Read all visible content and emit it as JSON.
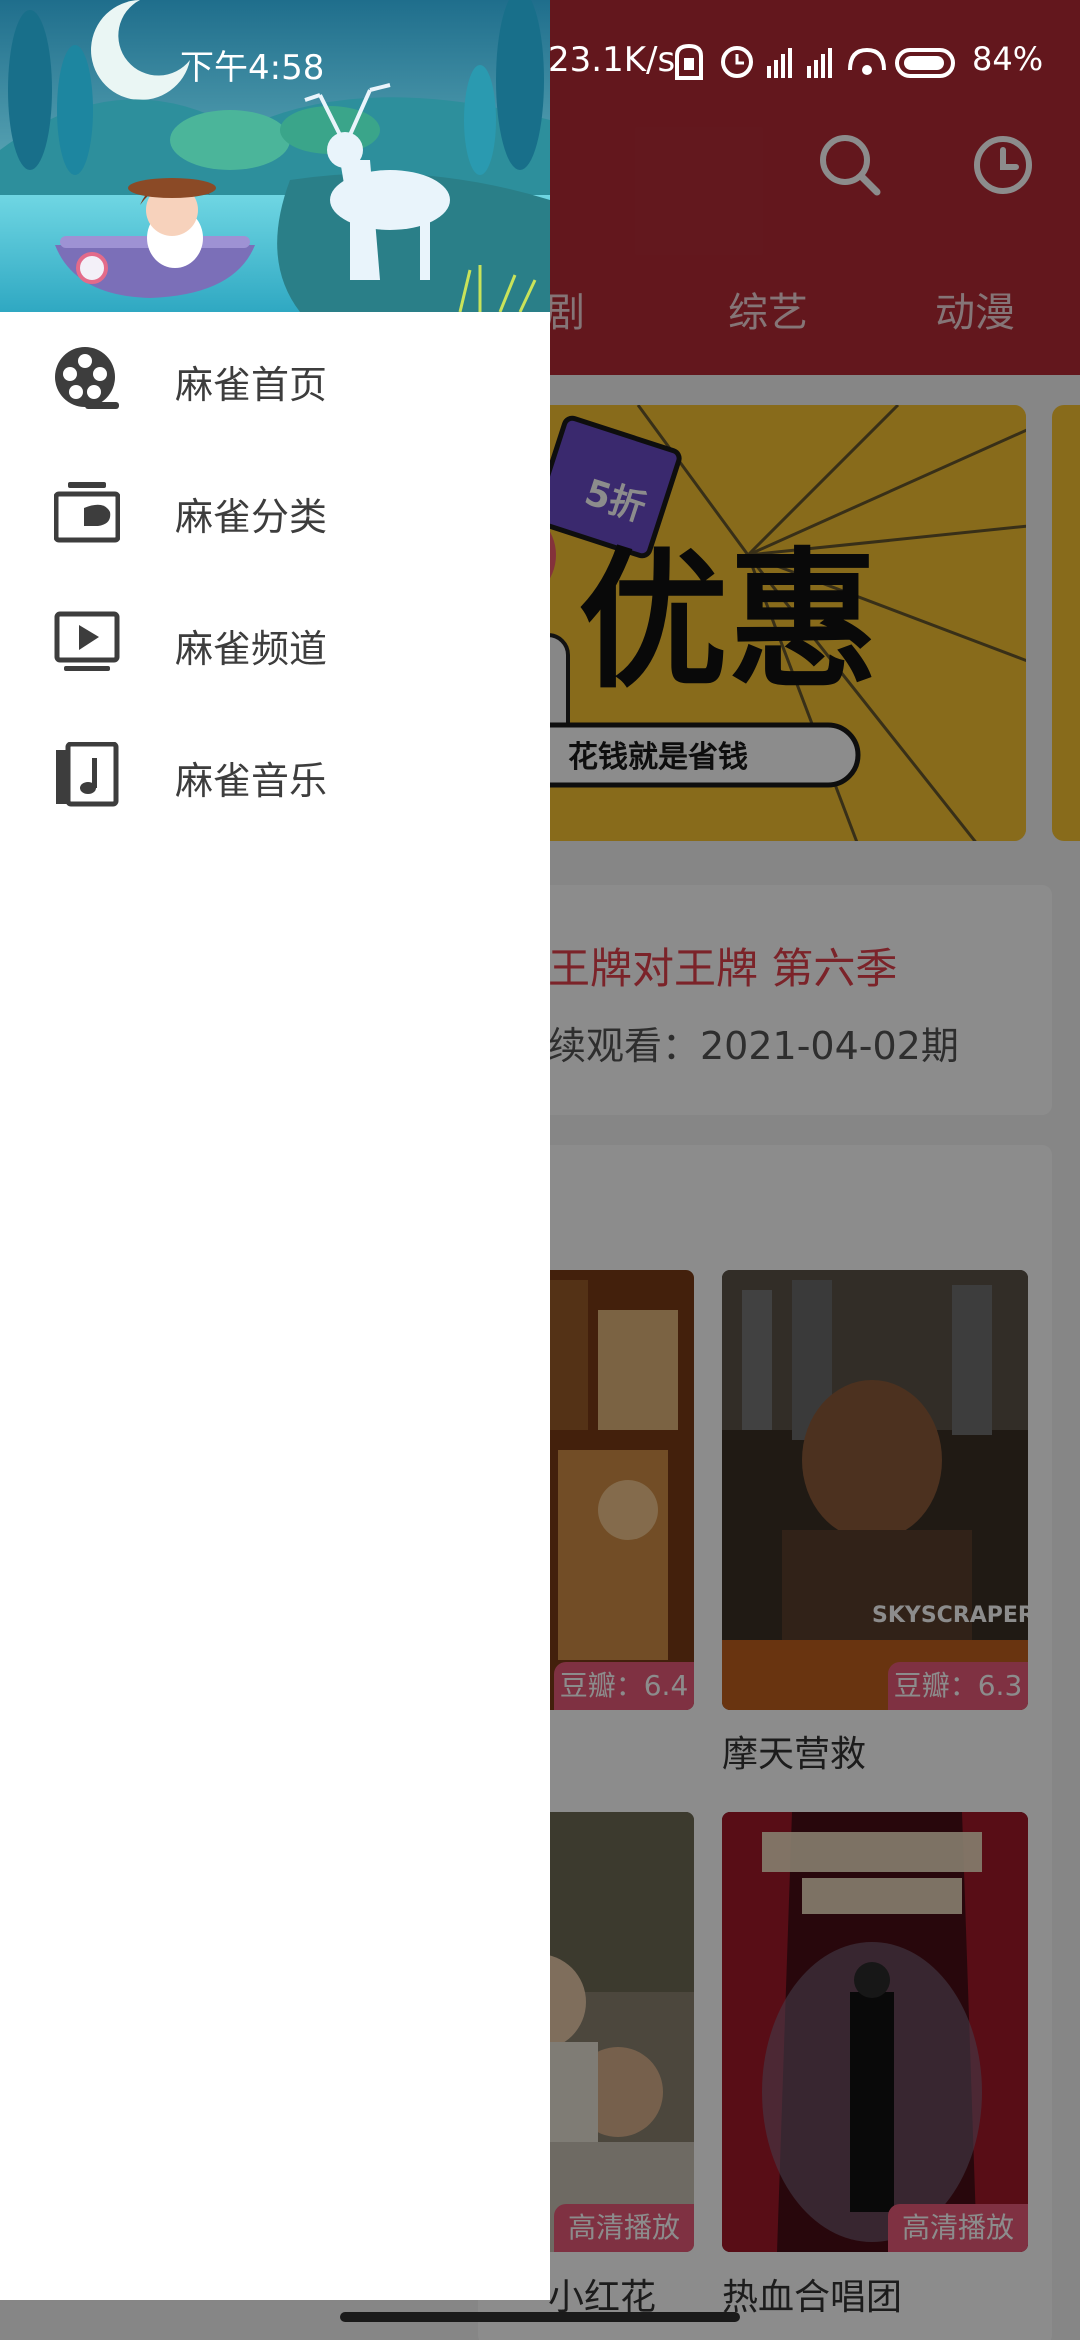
{
  "status_bar": {
    "time": "下午4:58",
    "net_speed": "23.1K/s",
    "battery": "84%"
  },
  "app": {
    "tabs": [
      {
        "label": "剧"
      },
      {
        "label": "综艺"
      },
      {
        "label": "动漫"
      }
    ],
    "banner": {
      "discount": "5折",
      "headline": "优惠",
      "slogan": "花钱就是省钱"
    },
    "recent": {
      "title": "王牌对王牌 第六季",
      "subtitle": "续观看：2021-04-02期"
    },
    "posters": [
      {
        "badge": "豆瓣：6.4",
        "caption": ""
      },
      {
        "badge": "豆瓣：6.3",
        "caption": "摩天营救",
        "poster_text": "SKYSCRAPER"
      },
      {
        "badge": "高清播放",
        "caption": "小红花"
      },
      {
        "badge": "高清播放",
        "caption": "热血合唱团"
      }
    ]
  },
  "drawer": {
    "menu": [
      {
        "label": "麻雀首页",
        "icon": "film-reel-icon"
      },
      {
        "label": "麻雀分类",
        "icon": "category-icon"
      },
      {
        "label": "麻雀频道",
        "icon": "play-screen-icon"
      },
      {
        "label": "麻雀音乐",
        "icon": "music-note-icon"
      }
    ]
  },
  "colors": {
    "app_bar": "#b52b36",
    "accent_red": "#e0404c",
    "badge_pink": "#e85a79",
    "drawer_text": "#3d3d3d"
  }
}
